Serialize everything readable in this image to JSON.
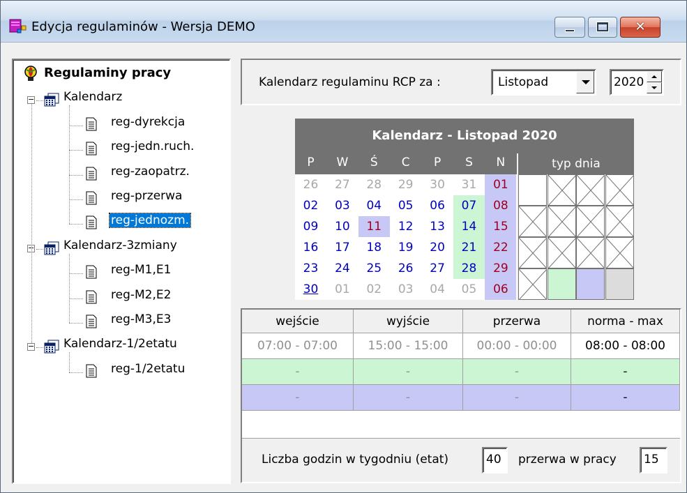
{
  "window": {
    "title": "Edycja regulaminów - Wersja DEMO"
  },
  "tree": {
    "root": "Regulaminy pracy",
    "groups": [
      {
        "label": "Kalendarz",
        "items": [
          "reg-dyrekcja",
          "reg-jedn.ruch.",
          "reg-zaopatrz.",
          "reg-przerwa",
          "reg-jednozm."
        ]
      },
      {
        "label": "Kalendarz-3zmiany",
        "items": [
          "reg-M1,E1",
          "reg-M2,E2",
          "reg-M3,E3"
        ]
      },
      {
        "label": "Kalendarz-1/2etatu",
        "items": [
          "reg-1/2etatu"
        ]
      }
    ],
    "selected": "reg-jednozm."
  },
  "header": {
    "label": "Kalendarz regulaminu RCP  za :",
    "month": "Listopad",
    "year": "2020"
  },
  "calendar": {
    "title": "Kalendarz - Listopad 2020",
    "weekdays": [
      "P",
      "W",
      "Ś",
      "C",
      "P",
      "S",
      "N"
    ],
    "typ_header": "typ dnia",
    "weeks": [
      [
        "26",
        "27",
        "28",
        "29",
        "30",
        "31",
        "01"
      ],
      [
        "02",
        "03",
        "04",
        "05",
        "06",
        "07",
        "08"
      ],
      [
        "09",
        "10",
        "11",
        "12",
        "13",
        "14",
        "15"
      ],
      [
        "16",
        "17",
        "18",
        "19",
        "20",
        "21",
        "22"
      ],
      [
        "23",
        "24",
        "25",
        "26",
        "27",
        "28",
        "29"
      ],
      [
        "30",
        "01",
        "02",
        "03",
        "04",
        "05",
        "06"
      ]
    ],
    "colors": {
      "work_text": "#0000c0",
      "sunday_text": "#a00020",
      "other_month_text": "#a8a8a8",
      "saturday_bg": "#ccf5d4",
      "sunday_bg": "#c8c8f6",
      "holiday_bg": "#c8c8f6"
    },
    "typ_cells": [
      [
        "white",
        "cross",
        "cross",
        "cross"
      ],
      [
        "cross",
        "cross",
        "cross",
        "cross"
      ],
      [
        "cross",
        "cross",
        "cross",
        "cross"
      ],
      [
        "cross",
        "green",
        "blue",
        "gray"
      ]
    ]
  },
  "schedule": {
    "headers": [
      "wejście",
      "wyjście",
      "przerwa",
      "norma - max"
    ],
    "rows": [
      {
        "bg": "#ffffff",
        "cells": [
          "07:00 - 07:00",
          "15:00 - 15:00",
          "00:00 - 00:00",
          "08:00 - 08:00"
        ]
      },
      {
        "bg": "#ccf5d4",
        "cells": [
          "-",
          "-",
          "-",
          "-"
        ]
      },
      {
        "bg": "#c8c8f6",
        "cells": [
          "-",
          "-",
          "-",
          "-"
        ]
      }
    ]
  },
  "footer": {
    "hours_label": "Liczba godzin w tygodniu (etat)",
    "hours_value": "40",
    "break_label": "przerwa w pracy",
    "break_value": "15"
  }
}
